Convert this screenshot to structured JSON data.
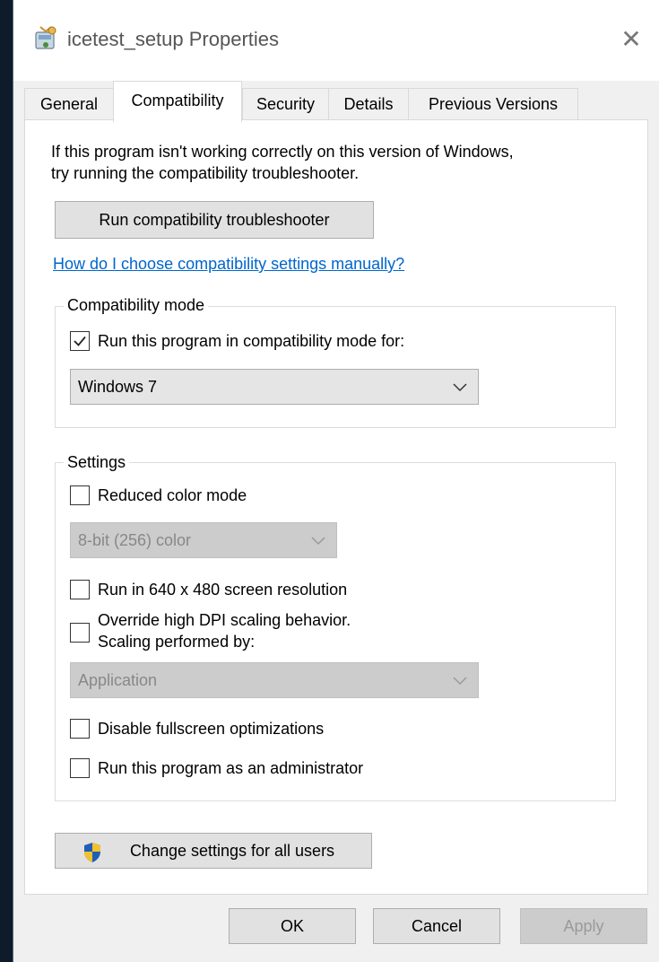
{
  "window": {
    "title": "icetest_setup Properties",
    "close_glyph": "✕"
  },
  "tabs": [
    {
      "label": "General",
      "active": false
    },
    {
      "label": "Compatibility",
      "active": true
    },
    {
      "label": "Security",
      "active": false
    },
    {
      "label": "Details",
      "active": false
    },
    {
      "label": "Previous Versions",
      "active": false
    }
  ],
  "intro": {
    "line1": "If this program isn't working correctly on this version of Windows,",
    "line2": "try running the compatibility troubleshooter."
  },
  "troubleshooter_button": "Run compatibility troubleshooter",
  "manual_link": "How do I choose compatibility settings manually?",
  "compat_mode": {
    "group_label": "Compatibility mode",
    "checkbox_label": "Run this program in compatibility mode for:",
    "checked": true,
    "selected_os": "Windows 7"
  },
  "settings": {
    "group_label": "Settings",
    "reduced_color_label": "Reduced color mode",
    "reduced_color_checked": false,
    "color_select_value": "8-bit (256) color",
    "res_640_label": "Run in 640 x 480 screen resolution",
    "res_640_checked": false,
    "dpi_label_line1": "Override high DPI scaling behavior.",
    "dpi_label_line2": "Scaling performed by:",
    "dpi_checked": false,
    "dpi_select_value": "Application",
    "fullscreen_label": "Disable fullscreen optimizations",
    "fullscreen_checked": false,
    "admin_label": "Run this program as an administrator",
    "admin_checked": false
  },
  "change_all_button": "Change settings for all users",
  "footer": {
    "ok": "OK",
    "cancel": "Cancel",
    "apply": "Apply"
  },
  "icons": {
    "title": "setup-package-icon",
    "shield": "uac-shield-icon",
    "check": "check-icon",
    "chevron": "chevron-down-icon",
    "close": "close-icon"
  }
}
